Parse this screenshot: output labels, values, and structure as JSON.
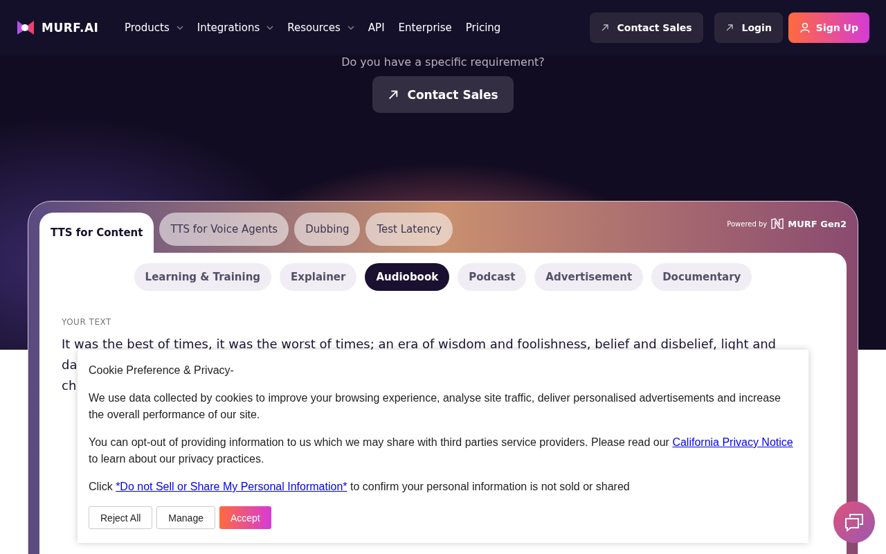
{
  "nav": {
    "brand": "MURF.AI",
    "items": [
      {
        "label": "Products",
        "dropdown": true
      },
      {
        "label": "Integrations",
        "dropdown": true
      },
      {
        "label": "Resources",
        "dropdown": true
      },
      {
        "label": "API",
        "dropdown": false
      },
      {
        "label": "Enterprise",
        "dropdown": false
      },
      {
        "label": "Pricing",
        "dropdown": false
      }
    ],
    "contact": "Contact Sales",
    "login": "Login",
    "signup": "Sign Up"
  },
  "hero": {
    "question": "Do you have a specific requirement?",
    "contact": "Contact Sales"
  },
  "demo": {
    "tabs": [
      {
        "label": "TTS for Content",
        "selected": true
      },
      {
        "label": "TTS for Voice Agents",
        "selected": false
      },
      {
        "label": "Dubbing",
        "selected": false
      },
      {
        "label": "Test Latency",
        "selected": false
      }
    ],
    "powered_by": "Powered by",
    "engine": "MURF Gen2",
    "categories": [
      {
        "label": "Learning & Training",
        "selected": false
      },
      {
        "label": "Explainer",
        "selected": false
      },
      {
        "label": "Audiobook",
        "selected": true
      },
      {
        "label": "Podcast",
        "selected": false
      },
      {
        "label": "Advertisement",
        "selected": false
      },
      {
        "label": "Documentary",
        "selected": false
      }
    ],
    "text_label": "YOUR TEXT",
    "text_lines": [
      "It was the best of times, it was the worst of times; an era of wisdom and foolishness, belief and disbelief, light and",
      "da",
      "ch"
    ]
  },
  "cookie": {
    "title": "Cookie Preference & Privacy-",
    "p1": "We use data collected by cookies to improve your browsing experience, analyse site traffic, deliver personalised advertisements and increase the overall performance of our site.",
    "p2_before": "You can opt-out of providing information to us which we may share with third parties service providers. Please read our",
    "p2_link": "California Privacy Notice",
    "p2_after": "to learn about our privacy practices.",
    "p3_before": "Click",
    "p3_link": "*Do not Sell or Share My Personal Information*",
    "p3_after": "to confirm your personal information is not sold or shared",
    "reject": "Reject All",
    "manage": "Manage",
    "accept": "Accept"
  }
}
